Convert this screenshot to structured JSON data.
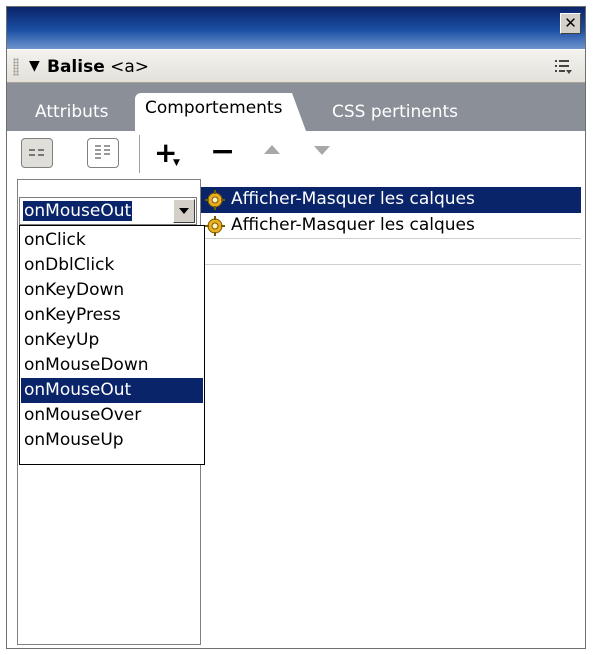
{
  "window": {
    "close_symbol": "✕"
  },
  "header": {
    "collapse_symbol": "▼",
    "title_bold": "Balise",
    "title_tag": "<a>"
  },
  "tabs": [
    {
      "label": "Attributs",
      "active": false
    },
    {
      "label": "Comportements",
      "active": true
    },
    {
      "label": "CSS pertinents",
      "active": false
    }
  ],
  "toolbar": {
    "add_symbol": "+",
    "add_caret": "▼",
    "remove_symbol": "−"
  },
  "event_select": {
    "value": "onMouseOut",
    "options": [
      "onClick",
      "onDblClick",
      "onKeyDown",
      "onKeyPress",
      "onKeyUp",
      "onMouseDown",
      "onMouseOut",
      "onMouseOver",
      "onMouseUp"
    ],
    "selected_index": 6
  },
  "actions": [
    {
      "label": "Afficher-Masquer les calques",
      "selected": true,
      "icon": "gear-icon"
    },
    {
      "label": "Afficher-Masquer les calques",
      "selected": false,
      "icon": "gear-icon"
    }
  ],
  "colors": {
    "selection": "#0a246a",
    "tabstrip": "#8b8f98",
    "panel": "#d4d0c8"
  }
}
